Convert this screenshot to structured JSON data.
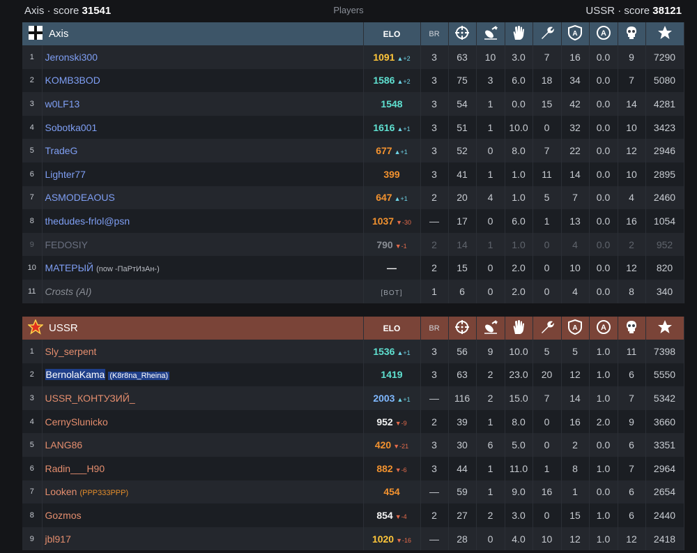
{
  "topbar": {
    "left_team": "Axis",
    "left_score_label": "· score",
    "left_score": "31541",
    "center": "Players",
    "right_team": "USSR",
    "right_score_label": "· score",
    "right_score": "38121"
  },
  "headers": {
    "elo": "ELO",
    "br": "BR"
  },
  "colors": {
    "axis_header": "#3d5568",
    "ussr_header": "#7a4438",
    "elo_up": "#6ed3e6",
    "elo_down": "#e56b4b"
  },
  "axis": {
    "title": "Axis",
    "rows": [
      {
        "n": "1",
        "name": "Jeronski300",
        "note": "",
        "elo": "1091",
        "elo_color": "c-yellow",
        "delta": "▲+2",
        "dir": "up",
        "br": "3",
        "a": "63",
        "b": "10",
        "c": "3.0",
        "d": "7",
        "e": "16",
        "f": "0.0",
        "g": "9",
        "h": "7290"
      },
      {
        "n": "2",
        "name": "KOMB3BOD",
        "note": "",
        "elo": "1586",
        "elo_color": "c-cyan",
        "delta": "▲+2",
        "dir": "up",
        "br": "3",
        "a": "75",
        "b": "3",
        "c": "6.0",
        "d": "18",
        "e": "34",
        "f": "0.0",
        "g": "7",
        "h": "5080"
      },
      {
        "n": "3",
        "name": "w0LF13",
        "note": "",
        "elo": "1548",
        "elo_color": "c-cyan",
        "delta": "",
        "dir": "",
        "br": "3",
        "a": "54",
        "b": "1",
        "c": "0.0",
        "d": "15",
        "e": "42",
        "f": "0.0",
        "g": "14",
        "h": "4281"
      },
      {
        "n": "4",
        "name": "Sobotka001",
        "note": "",
        "elo": "1616",
        "elo_color": "c-cyan",
        "delta": "▲+1",
        "dir": "up",
        "br": "3",
        "a": "51",
        "b": "1",
        "c": "10.0",
        "d": "0",
        "e": "32",
        "f": "0.0",
        "g": "10",
        "h": "3423"
      },
      {
        "n": "5",
        "name": "TradeG",
        "note": "",
        "elo": "677",
        "elo_color": "c-orange",
        "delta": "▲+1",
        "dir": "up",
        "br": "3",
        "a": "52",
        "b": "0",
        "c": "8.0",
        "d": "7",
        "e": "22",
        "f": "0.0",
        "g": "12",
        "h": "2946"
      },
      {
        "n": "6",
        "name": "Lighter77",
        "note": "",
        "elo": "399",
        "elo_color": "c-orange",
        "delta": "",
        "dir": "",
        "br": "3",
        "a": "41",
        "b": "1",
        "c": "1.0",
        "d": "11",
        "e": "14",
        "f": "0.0",
        "g": "10",
        "h": "2895"
      },
      {
        "n": "7",
        "name": "ASMODEAOUS",
        "note": "",
        "elo": "647",
        "elo_color": "c-orange",
        "delta": "▲+1",
        "dir": "up",
        "br": "2",
        "a": "20",
        "b": "4",
        "c": "1.0",
        "d": "5",
        "e": "7",
        "f": "0.0",
        "g": "4",
        "h": "2460"
      },
      {
        "n": "8",
        "name": "thedudes-frlol@psn",
        "note": "",
        "elo": "1037",
        "elo_color": "c-orange",
        "delta": "▼-30",
        "dir": "dn",
        "br": "—",
        "a": "17",
        "b": "0",
        "c": "6.0",
        "d": "1",
        "e": "13",
        "f": "0.0",
        "g": "16",
        "h": "1054"
      },
      {
        "n": "9",
        "name": "FEDOSIY",
        "note": "",
        "elo": "790",
        "elo_color": "c-grey",
        "delta": "▼-1",
        "dir": "dn",
        "br": "2",
        "a": "14",
        "b": "1",
        "c": "1.0",
        "d": "0",
        "e": "4",
        "f": "0.0",
        "g": "2",
        "h": "952",
        "dim": true
      },
      {
        "n": "10",
        "name": "МАТЕРЫЙ",
        "note": "(now -ПаРтИзАн-)",
        "elo": "—",
        "elo_color": "c-white",
        "delta": "",
        "dir": "",
        "br": "2",
        "a": "15",
        "b": "0",
        "c": "2.0",
        "d": "0",
        "e": "10",
        "f": "0.0",
        "g": "12",
        "h": "820"
      },
      {
        "n": "11",
        "name": "Crosts (AI)",
        "note": "",
        "elo": "[BOT]",
        "elo_color": "c-small",
        "delta": "",
        "dir": "",
        "br": "1",
        "a": "6",
        "b": "0",
        "c": "2.0",
        "d": "0",
        "e": "4",
        "f": "0.0",
        "g": "8",
        "h": "340",
        "italic": true
      }
    ]
  },
  "ussr": {
    "title": "USSR",
    "rows": [
      {
        "n": "1",
        "name": "Sly_serpent",
        "note": "",
        "elo": "1536",
        "elo_color": "c-cyan",
        "delta": "▲+1",
        "dir": "up",
        "br": "3",
        "a": "56",
        "b": "9",
        "c": "10.0",
        "d": "5",
        "e": "5",
        "f": "1.0",
        "g": "11",
        "h": "7398"
      },
      {
        "n": "2",
        "name": "BernolaKama",
        "note": "(K8r8na_Rheina)",
        "elo": "1419",
        "elo_color": "c-cyan",
        "delta": "",
        "dir": "",
        "br": "3",
        "a": "63",
        "b": "2",
        "c": "23.0",
        "d": "20",
        "e": "12",
        "f": "1.0",
        "g": "6",
        "h": "5550",
        "highlight": true
      },
      {
        "n": "3",
        "name": "USSR_КОНТУЗИЙ_",
        "note": "",
        "elo": "2003",
        "elo_color": "c-blue",
        "delta": "▲+1",
        "dir": "up",
        "br": "—",
        "a": "116",
        "b": "2",
        "c": "15.0",
        "d": "7",
        "e": "14",
        "f": "1.0",
        "g": "7",
        "h": "5342"
      },
      {
        "n": "4",
        "name": "CernySlunicko",
        "note": "",
        "elo": "952",
        "elo_color": "c-white",
        "delta": "▼-9",
        "dir": "dn",
        "br": "2",
        "a": "39",
        "b": "1",
        "c": "8.0",
        "d": "0",
        "e": "16",
        "f": "2.0",
        "g": "9",
        "h": "3660"
      },
      {
        "n": "5",
        "name": "LANG86",
        "note": "",
        "elo": "420",
        "elo_color": "c-orange",
        "delta": "▼-21",
        "dir": "dn",
        "br": "3",
        "a": "30",
        "b": "6",
        "c": "5.0",
        "d": "0",
        "e": "2",
        "f": "0.0",
        "g": "6",
        "h": "3351"
      },
      {
        "n": "6",
        "name": "Radin___H90",
        "note": "",
        "elo": "882",
        "elo_color": "c-orange",
        "delta": "▼-6",
        "dir": "dn",
        "br": "3",
        "a": "44",
        "b": "1",
        "c": "11.0",
        "d": "1",
        "e": "8",
        "f": "1.0",
        "g": "7",
        "h": "2964"
      },
      {
        "n": "7",
        "name": "Looken",
        "note": "(PPP333PPP)",
        "elo": "454",
        "elo_color": "c-orange",
        "delta": "",
        "dir": "",
        "br": "—",
        "a": "59",
        "b": "1",
        "c": "9.0",
        "d": "16",
        "e": "1",
        "f": "0.0",
        "g": "6",
        "h": "2654",
        "note_orange": true
      },
      {
        "n": "8",
        "name": "Gozmos",
        "note": "",
        "elo": "854",
        "elo_color": "c-white",
        "delta": "▼-4",
        "dir": "dn",
        "br": "2",
        "a": "27",
        "b": "2",
        "c": "3.0",
        "d": "0",
        "e": "15",
        "f": "1.0",
        "g": "6",
        "h": "2440"
      },
      {
        "n": "9",
        "name": "jbl917",
        "note": "",
        "elo": "1020",
        "elo_color": "c-yellow",
        "delta": "▼-16",
        "dir": "dn",
        "br": "—",
        "a": "28",
        "b": "0",
        "c": "4.0",
        "d": "10",
        "e": "12",
        "f": "1.0",
        "g": "12",
        "h": "2418"
      }
    ]
  },
  "column_icons": [
    "crosshair-icon",
    "bomb-icon",
    "hand-icon",
    "wrench-icon",
    "shield-a-icon",
    "circle-a-icon",
    "skull-icon",
    "star-icon"
  ]
}
